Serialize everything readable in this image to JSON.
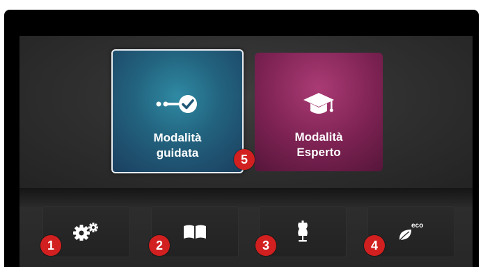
{
  "modes": {
    "guided": {
      "line1": "Modalità",
      "line2": "guidata",
      "icon": "guided-steps-icon",
      "color": "#22627e",
      "selected": true
    },
    "expert": {
      "line1": "Modalità",
      "line2": "Esperto",
      "icon": "graduation-cap-icon",
      "color": "#7d2253"
    }
  },
  "toolbar": [
    {
      "icon": "settings-gears-icon",
      "badge": "1"
    },
    {
      "icon": "book-icon",
      "badge": "2"
    },
    {
      "icon": "dress-form-icon",
      "badge": "3"
    },
    {
      "icon": "eco-leaf-icon",
      "badge": "4",
      "icon_text": "eco"
    }
  ],
  "callout_badge": "5",
  "colors": {
    "badge": "#d21f1f",
    "background": "#2e2e2e"
  }
}
